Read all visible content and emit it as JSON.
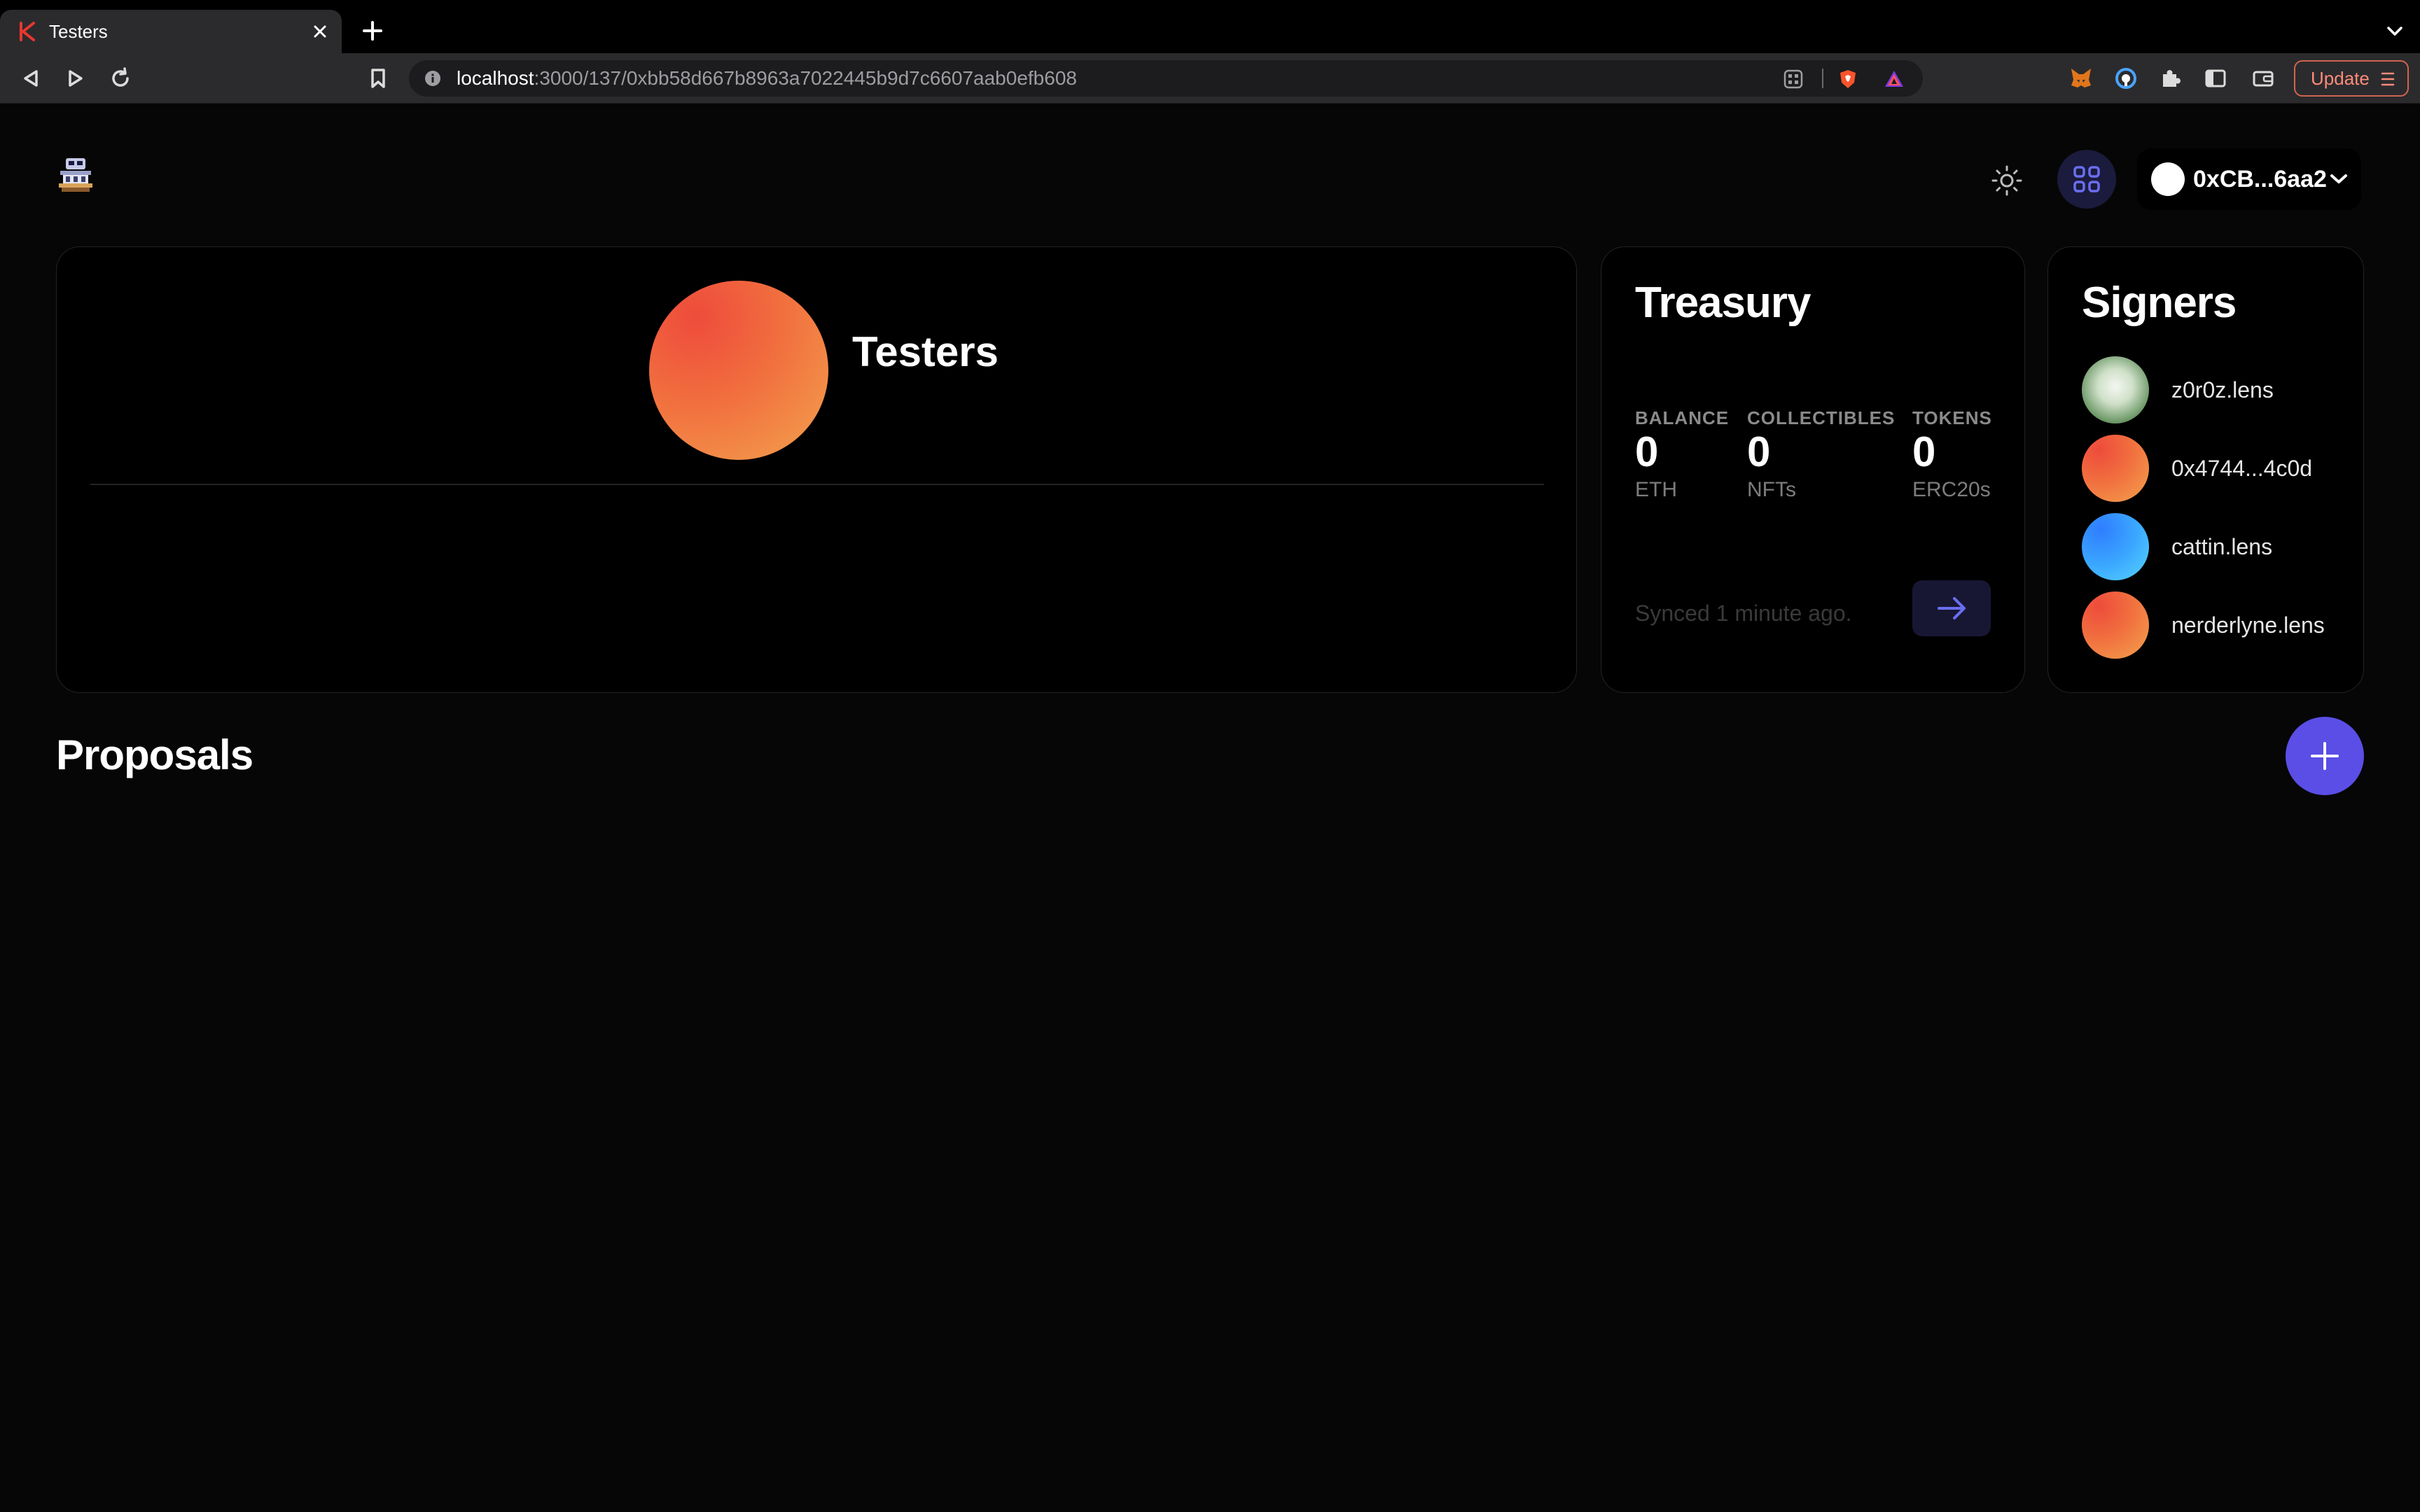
{
  "browser": {
    "tab_title": "Testers",
    "url_host": "localhost",
    "url_path": ":3000/137/0xbb58d667b8963a7022445b9d7c6607aab0efb608",
    "update_label": "Update"
  },
  "header": {
    "wallet_label": "0xCB...6aa2"
  },
  "group": {
    "name": "Testers"
  },
  "treasury": {
    "title": "Treasury",
    "stats": [
      {
        "label": "BALANCE",
        "value": "0",
        "unit": "ETH"
      },
      {
        "label": "COLLECTIBLES",
        "value": "0",
        "unit": "NFTs"
      },
      {
        "label": "TOKENS",
        "value": "0",
        "unit": "ERC20s"
      }
    ],
    "synced": "Synced 1 minute ago."
  },
  "signers": {
    "title": "Signers",
    "items": [
      {
        "name": "z0r0z.lens"
      },
      {
        "name": "0x4744...4c0d"
      },
      {
        "name": "cattin.lens"
      },
      {
        "name": "nerderlyne.lens"
      }
    ]
  },
  "proposals": {
    "title": "Proposals"
  },
  "colors": {
    "accent": "#5a4ee6",
    "background": "#060606",
    "card": "#000000"
  },
  "icons": [
    "k-favicon",
    "close-icon",
    "plus-icon",
    "chevron-down-icon",
    "back-icon",
    "forward-icon",
    "reload-icon",
    "bookmark-icon",
    "info-icon",
    "qr-icon",
    "brave-shield-icon",
    "brave-rewards-icon",
    "metamask-icon",
    "password-icon",
    "puzzle-icon",
    "sidebar-icon",
    "wallet-icon",
    "hamburger-icon",
    "sun-icon",
    "grid-icon",
    "arrow-right-icon"
  ]
}
